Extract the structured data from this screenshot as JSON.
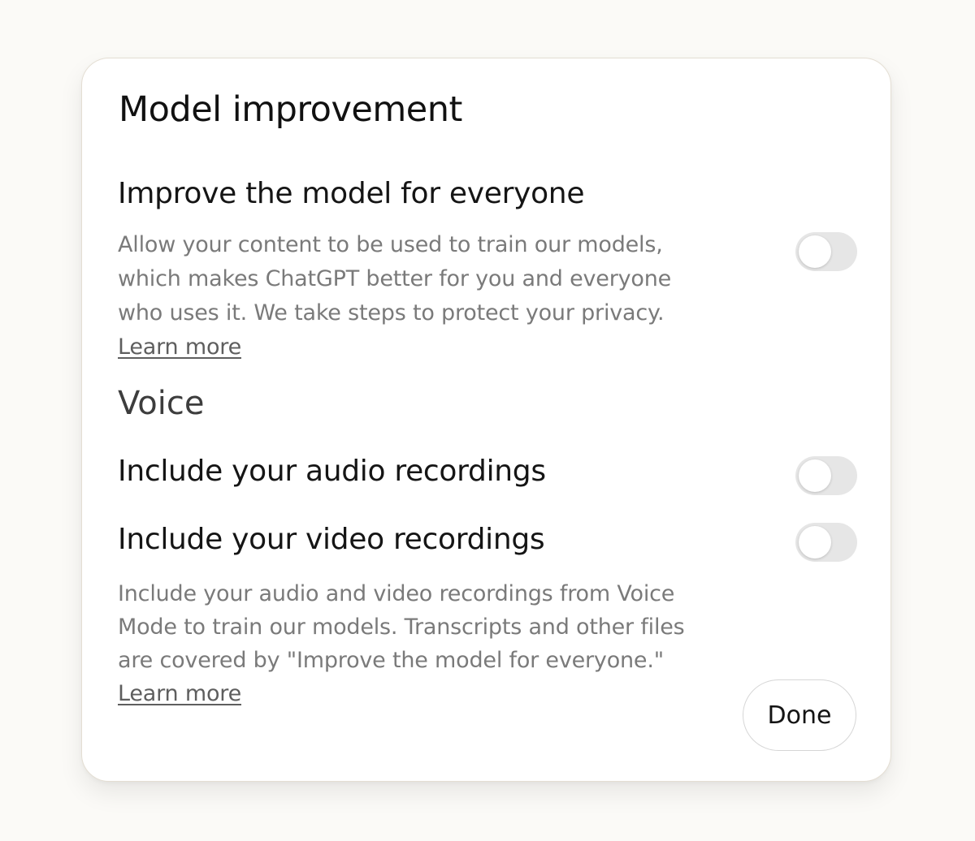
{
  "dialog": {
    "title": "Model improvement",
    "improve_model": {
      "label": "Improve the model for everyone",
      "description": "Allow your content to be used to train our models, which makes ChatGPT better for you and everyone who uses it. We take steps to protect your privacy.",
      "link_text": "Learn more",
      "toggle_on": false
    },
    "voice": {
      "heading": "Voice",
      "audio": {
        "label": "Include your audio recordings",
        "toggle_on": false
      },
      "video": {
        "label": "Include your video recordings",
        "toggle_on": false
      },
      "description": "Include your audio and video recordings from Voice Mode to train our models. Transcripts and other files are covered by \"Improve the model for everyone.\"",
      "link_text": "Learn more"
    },
    "done_label": "Done"
  }
}
